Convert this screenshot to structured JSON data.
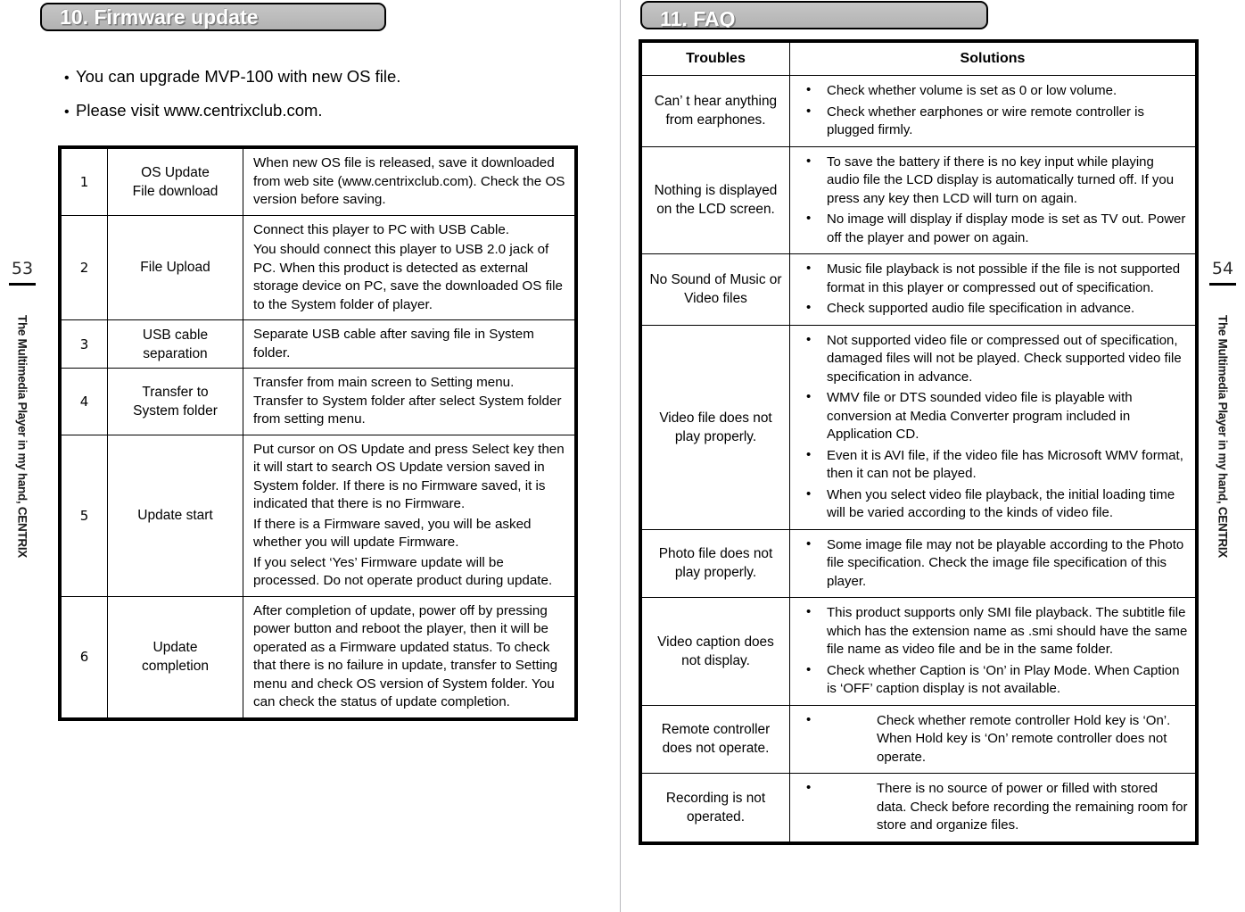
{
  "left_page": {
    "banner_title": "10. Firmware update",
    "intro_bullets": [
      "You can upgrade MVP-100 with new OS file.",
      "Please visit www.centrixclub.com."
    ],
    "page_number": "53",
    "margin_text": "The Multimedia Player in my hand, CENTRIX",
    "table": {
      "rows": [
        {
          "no": "1",
          "step": "OS Update\nFile download",
          "paragraphs": [
            "When new OS file is released, save it downloaded from web site (www.centrixclub.com). Check the OS version before saving."
          ]
        },
        {
          "no": "2",
          "step": "File Upload",
          "paragraphs": [
            "Connect this player to PC with USB Cable.",
            "You should connect this player to USB 2.0 jack of PC. When this product is detected as external storage device on PC, save the downloaded OS file to the System folder of player."
          ]
        },
        {
          "no": "3",
          "step": "USB cable\nseparation",
          "paragraphs": [
            "Separate USB cable after saving file in System folder."
          ]
        },
        {
          "no": "4",
          "step": "Transfer to\nSystem  folder",
          "paragraphs": [
            "Transfer from main screen to Setting menu. Transfer to System folder after select System folder from setting menu."
          ]
        },
        {
          "no": "5",
          "step": "Update start",
          "paragraphs": [
            "Put cursor on OS Update and press Select key then it will start to search OS Update version saved in System folder. If there is no Firmware saved, it is indicated that there is no Firmware.",
            "If there is a Firmware saved, you will be asked whether you will update Firmware.",
            "If you select ‘Yes’ Firmware update will be processed. Do not operate product during update."
          ]
        },
        {
          "no": "6",
          "step": "Update\ncompletion",
          "paragraphs": [
            "After completion of update, power off by pressing power button and reboot the player, then it will be operated as a Firmware updated status. To check that there is no failure in update, transfer to Setting menu and check OS version of System folder. You can check the status of update completion."
          ]
        }
      ]
    }
  },
  "right_page": {
    "banner_title": "11. FAQ",
    "page_number": "54",
    "margin_text": "The Multimedia Player in my hand, CENTRIX",
    "table": {
      "headers": {
        "trouble": "Troubles",
        "solution": "Solutions"
      },
      "rows": [
        {
          "trouble": "Can’ t hear anything  from earphones.",
          "wide_indent": false,
          "solutions": [
            "Check whether volume is set as 0 or low volume.",
            "Check whether earphones or wire remote controller is plugged firmly."
          ]
        },
        {
          "trouble": "Nothing is displayed on the LCD screen.",
          "wide_indent": false,
          "solutions": [
            "To save the battery if there is no key input while playing audio file the LCD display is automatically turned off. If you press any key then LCD will turn on again.",
            "No image will display if display mode is set as TV out. Power off the player and power on again."
          ]
        },
        {
          "trouble": "No Sound of Music or Video files",
          "wide_indent": false,
          "solutions": [
            "Music file playback is not possible if the file is not supported format in this player or compressed out of specification.",
            "Check supported audio file specification in advance."
          ]
        },
        {
          "trouble": "Video file does not play properly.",
          "wide_indent": false,
          "solutions": [
            "Not supported video file or compressed out of specification, damaged files will not be played. Check supported video file specification in advance.",
            "WMV file or DTS sounded video file is playable with conversion at Media Converter program included in Application CD.",
            "Even it is AVI file, if the video file has Microsoft WMV format, then it can not be played.",
            "When you select video file playback, the initial loading time will be varied according to the kinds of video file."
          ]
        },
        {
          "trouble": "Photo file does not play properly.",
          "wide_indent": false,
          "solutions": [
            "Some image file may not be playable according to the Photo file specification. Check the image file specification of this player."
          ]
        },
        {
          "trouble": "Video caption does not display.",
          "wide_indent": false,
          "solutions": [
            "This product supports only SMI file playback. The subtitle file which has the extension name as .smi should have the same file name as video file and be in the same folder.",
            "Check whether Caption is ‘On’ in Play Mode. When Caption is ‘OFF’ caption display is not available."
          ]
        },
        {
          "trouble": "Remote controller does not operate.",
          "wide_indent": true,
          "solutions": [
            "Check whether remote controller Hold key is ‘On’. When Hold key is ‘On’ remote controller does not operate."
          ]
        },
        {
          "trouble": "Recording is not operated.",
          "wide_indent": true,
          "solutions": [
            "There is no source of power or filled with stored data. Check before recording the remaining room for store and organize files."
          ]
        }
      ]
    }
  },
  "icons": {
    "bullet_glyph": "•",
    "intro_bullet_glyph": "•"
  }
}
